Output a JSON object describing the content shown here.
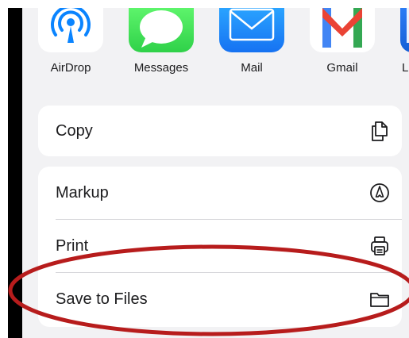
{
  "share_sheet": {
    "apps": [
      {
        "label": "AirDrop",
        "icon": "airdrop-icon"
      },
      {
        "label": "Messages",
        "icon": "messages-icon"
      },
      {
        "label": "Mail",
        "icon": "mail-icon"
      },
      {
        "label": "Gmail",
        "icon": "gmail-icon"
      },
      {
        "label": "L",
        "icon": "app-icon-partial"
      }
    ],
    "copy_action": {
      "label": "Copy",
      "icon": "copy-icon"
    },
    "actions": [
      {
        "label": "Markup",
        "icon": "markup-icon"
      },
      {
        "label": "Print",
        "icon": "print-icon"
      },
      {
        "label": "Save to Files",
        "icon": "folder-icon"
      }
    ]
  },
  "annotation": {
    "shape": "ellipse",
    "color": "#b71c1c",
    "target": "Save to Files"
  }
}
